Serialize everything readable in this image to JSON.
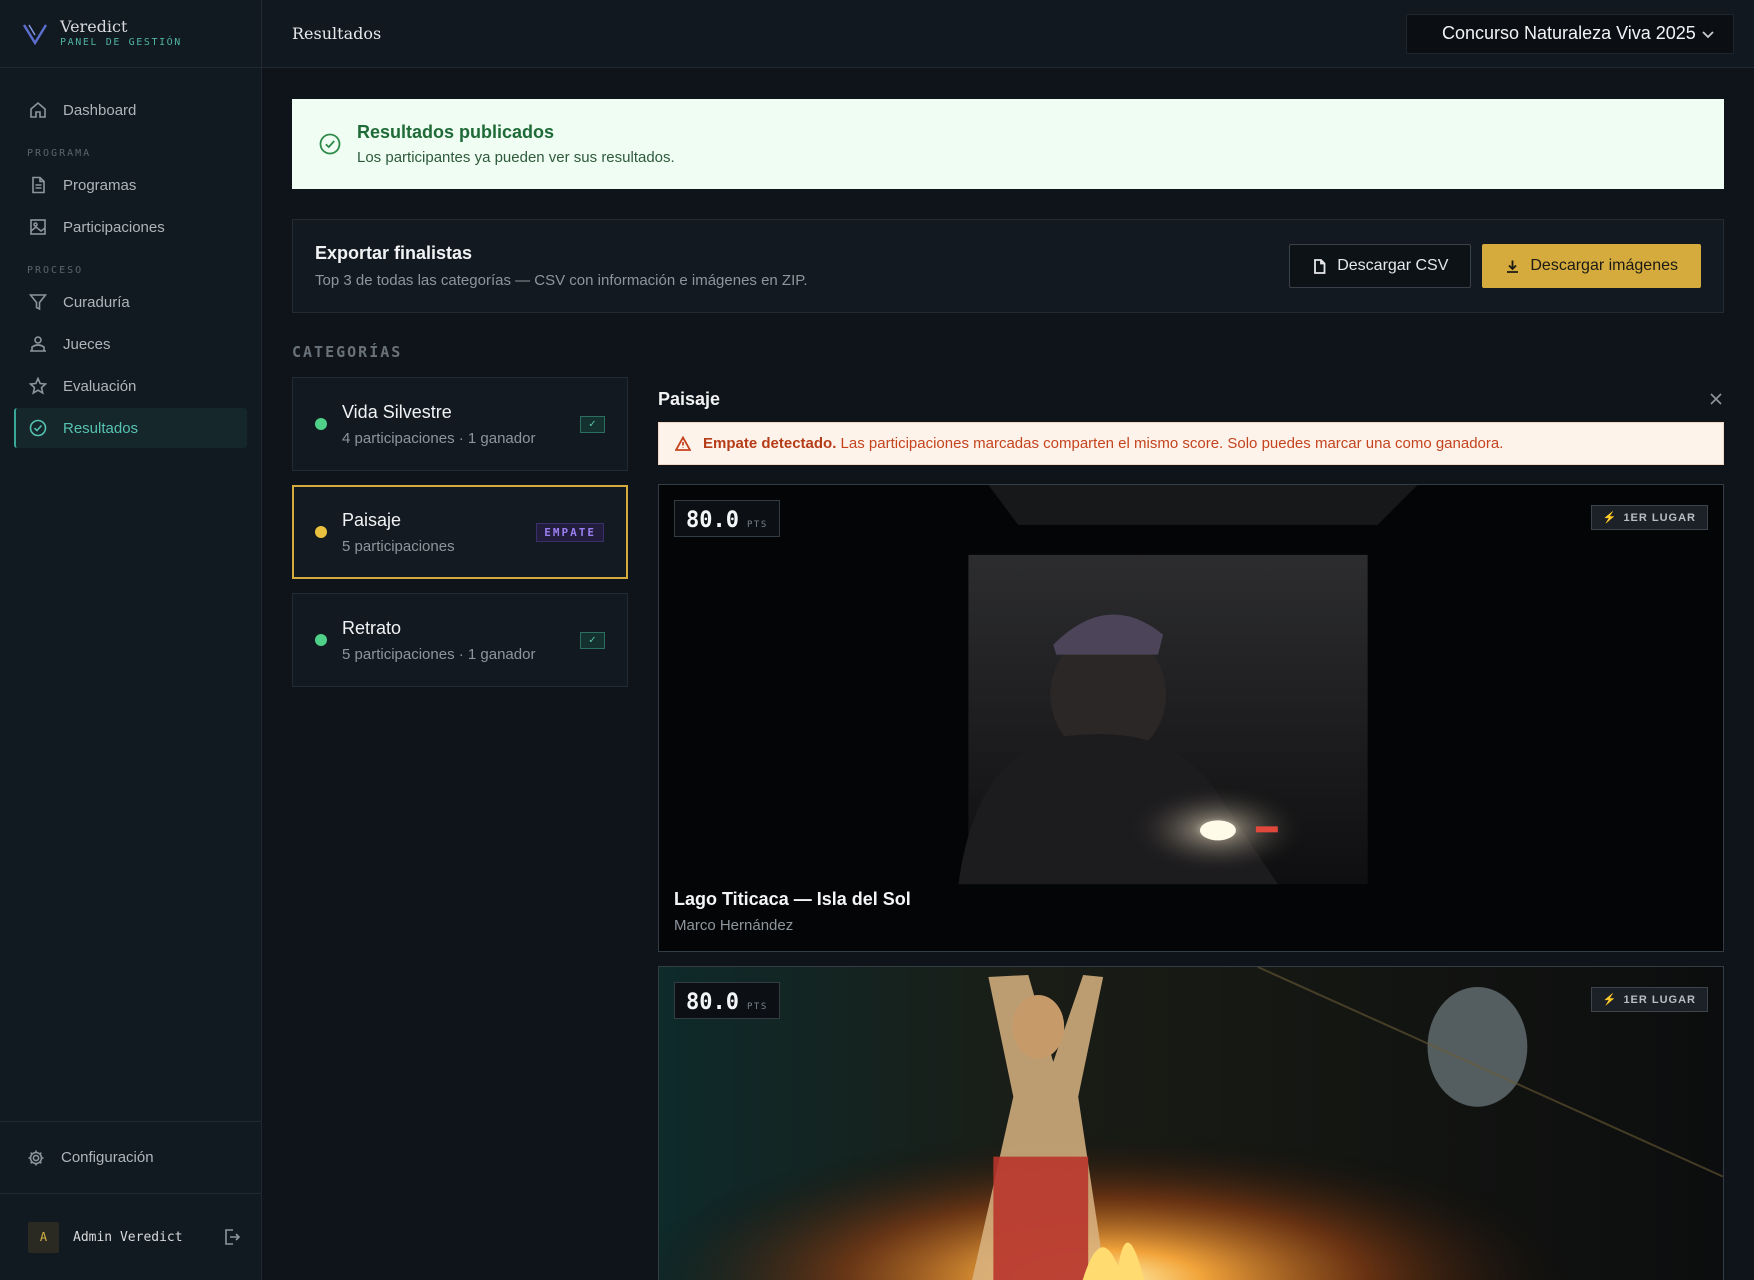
{
  "brand": {
    "name": "Veredict",
    "subtitle": "PANEL DE GESTIÓN"
  },
  "sidebar": {
    "dashboard": "Dashboard",
    "section_programa": "PROGRAMA",
    "programas": "Programas",
    "participaciones": "Participaciones",
    "section_proceso": "PROCESO",
    "curaduria": "Curaduría",
    "jueces": "Jueces",
    "evaluacion": "Evaluación",
    "resultados": "Resultados",
    "configuracion": "Configuración",
    "user_initial": "A",
    "user_name": "Admin Veredict"
  },
  "topbar": {
    "title": "Resultados",
    "contest": "Concurso Naturaleza Viva 2025"
  },
  "banner": {
    "title": "Resultados publicados",
    "message": "Los participantes ya pueden ver sus resultados."
  },
  "export": {
    "title": "Exportar finalistas",
    "description": "Top 3 de todas las categorías — CSV con información e imágenes en ZIP.",
    "csv_label": "Descargar CSV",
    "images_label": "Descargar imágenes"
  },
  "categories_label": "CATEGORÍAS",
  "categories": [
    {
      "name": "Vida Silvestre",
      "meta": "4 participaciones · 1 ganador",
      "badge": "✓",
      "status_color": "#4fd087"
    },
    {
      "name": "Paisaje",
      "meta": "5 participaciones",
      "badge": "EMPATE",
      "status_color": "#e9c13f"
    },
    {
      "name": "Retrato",
      "meta": "5 participaciones · 1 ganador",
      "badge": "✓",
      "status_color": "#4fd087"
    }
  ],
  "detail": {
    "title": "Paisaje",
    "alert_strong": "Empate detectado.",
    "alert_text": "Las participaciones marcadas comparten el mismo score. Solo puedes marcar una como ganadora.",
    "entries": [
      {
        "score": "80.0",
        "unit": "PTS",
        "place": "1ER LUGAR",
        "title": "Lago Titicaca — Isla del Sol",
        "author": "Marco Hernández"
      },
      {
        "score": "80.0",
        "unit": "PTS",
        "place": "1ER LUGAR"
      }
    ]
  },
  "colors": {
    "accent_teal": "#56c2b2",
    "accent_gold": "#d5ab3d",
    "success": "#2f8a4a",
    "warning": "#c3441f",
    "tie_purple": "#9a7ef0"
  }
}
